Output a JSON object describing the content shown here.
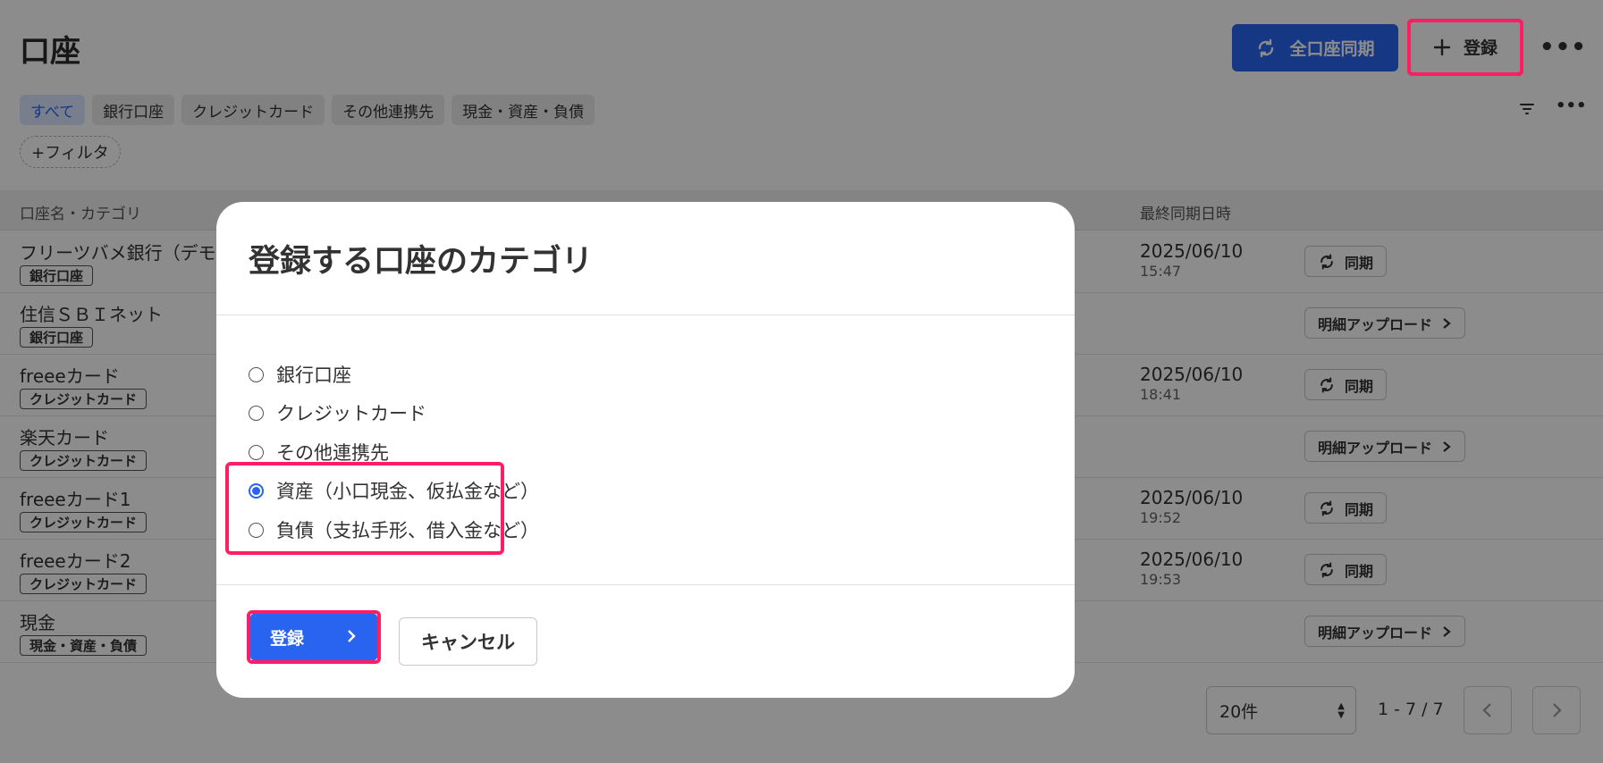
{
  "page": {
    "title": "口座",
    "sync_all_label": "全口座同期",
    "register_label": "登録",
    "more_label": "•••",
    "more_small_label": "•••"
  },
  "filters": {
    "chips": [
      "すべて",
      "銀行口座",
      "クレジットカード",
      "その他連携先",
      "現金・資産・負債"
    ],
    "add_filter_label": "+フィルタ"
  },
  "table": {
    "col_name": "口座名・カテゴリ",
    "col_last_sync": "最終同期日時",
    "rows": [
      {
        "name": "フリーツバメ銀行（デモ",
        "category": "銀行口座",
        "date": "2025/06/10",
        "time": "15:47",
        "action": "同期"
      },
      {
        "name": "住信ＳＢＩネット",
        "category": "銀行口座",
        "date": "",
        "time": "",
        "action": "明細アップロード"
      },
      {
        "name": "freeeカード",
        "category": "クレジットカード",
        "date": "2025/06/10",
        "time": "18:41",
        "action": "同期"
      },
      {
        "name": "楽天カード",
        "category": "クレジットカード",
        "date": "",
        "time": "",
        "action": "明細アップロード"
      },
      {
        "name": "freeeカード1",
        "category": "クレジットカード",
        "date": "2025/06/10",
        "time": "19:52",
        "action": "同期"
      },
      {
        "name": "freeeカード2",
        "category": "クレジットカード",
        "date": "2025/06/10",
        "time": "19:53",
        "action": "同期"
      },
      {
        "name": "現金",
        "category": "現金・資産・負債",
        "date": "",
        "time": "",
        "action": "明細アップロード"
      }
    ]
  },
  "pagination": {
    "per_page": "20件",
    "range": "1 - 7 / 7"
  },
  "modal": {
    "title": "登録する口座のカテゴリ",
    "options": [
      {
        "label": "銀行口座",
        "checked": false
      },
      {
        "label": "クレジットカード",
        "checked": false
      },
      {
        "label": "その他連携先",
        "checked": false
      },
      {
        "label": "資産（小口現金、仮払金など）",
        "checked": true
      },
      {
        "label": "負債（支払手形、借入金など）",
        "checked": false
      }
    ],
    "submit_label": "登録",
    "cancel_label": "キャンセル"
  },
  "colors": {
    "primary": "#2864f0",
    "highlight": "#ff1e64"
  }
}
